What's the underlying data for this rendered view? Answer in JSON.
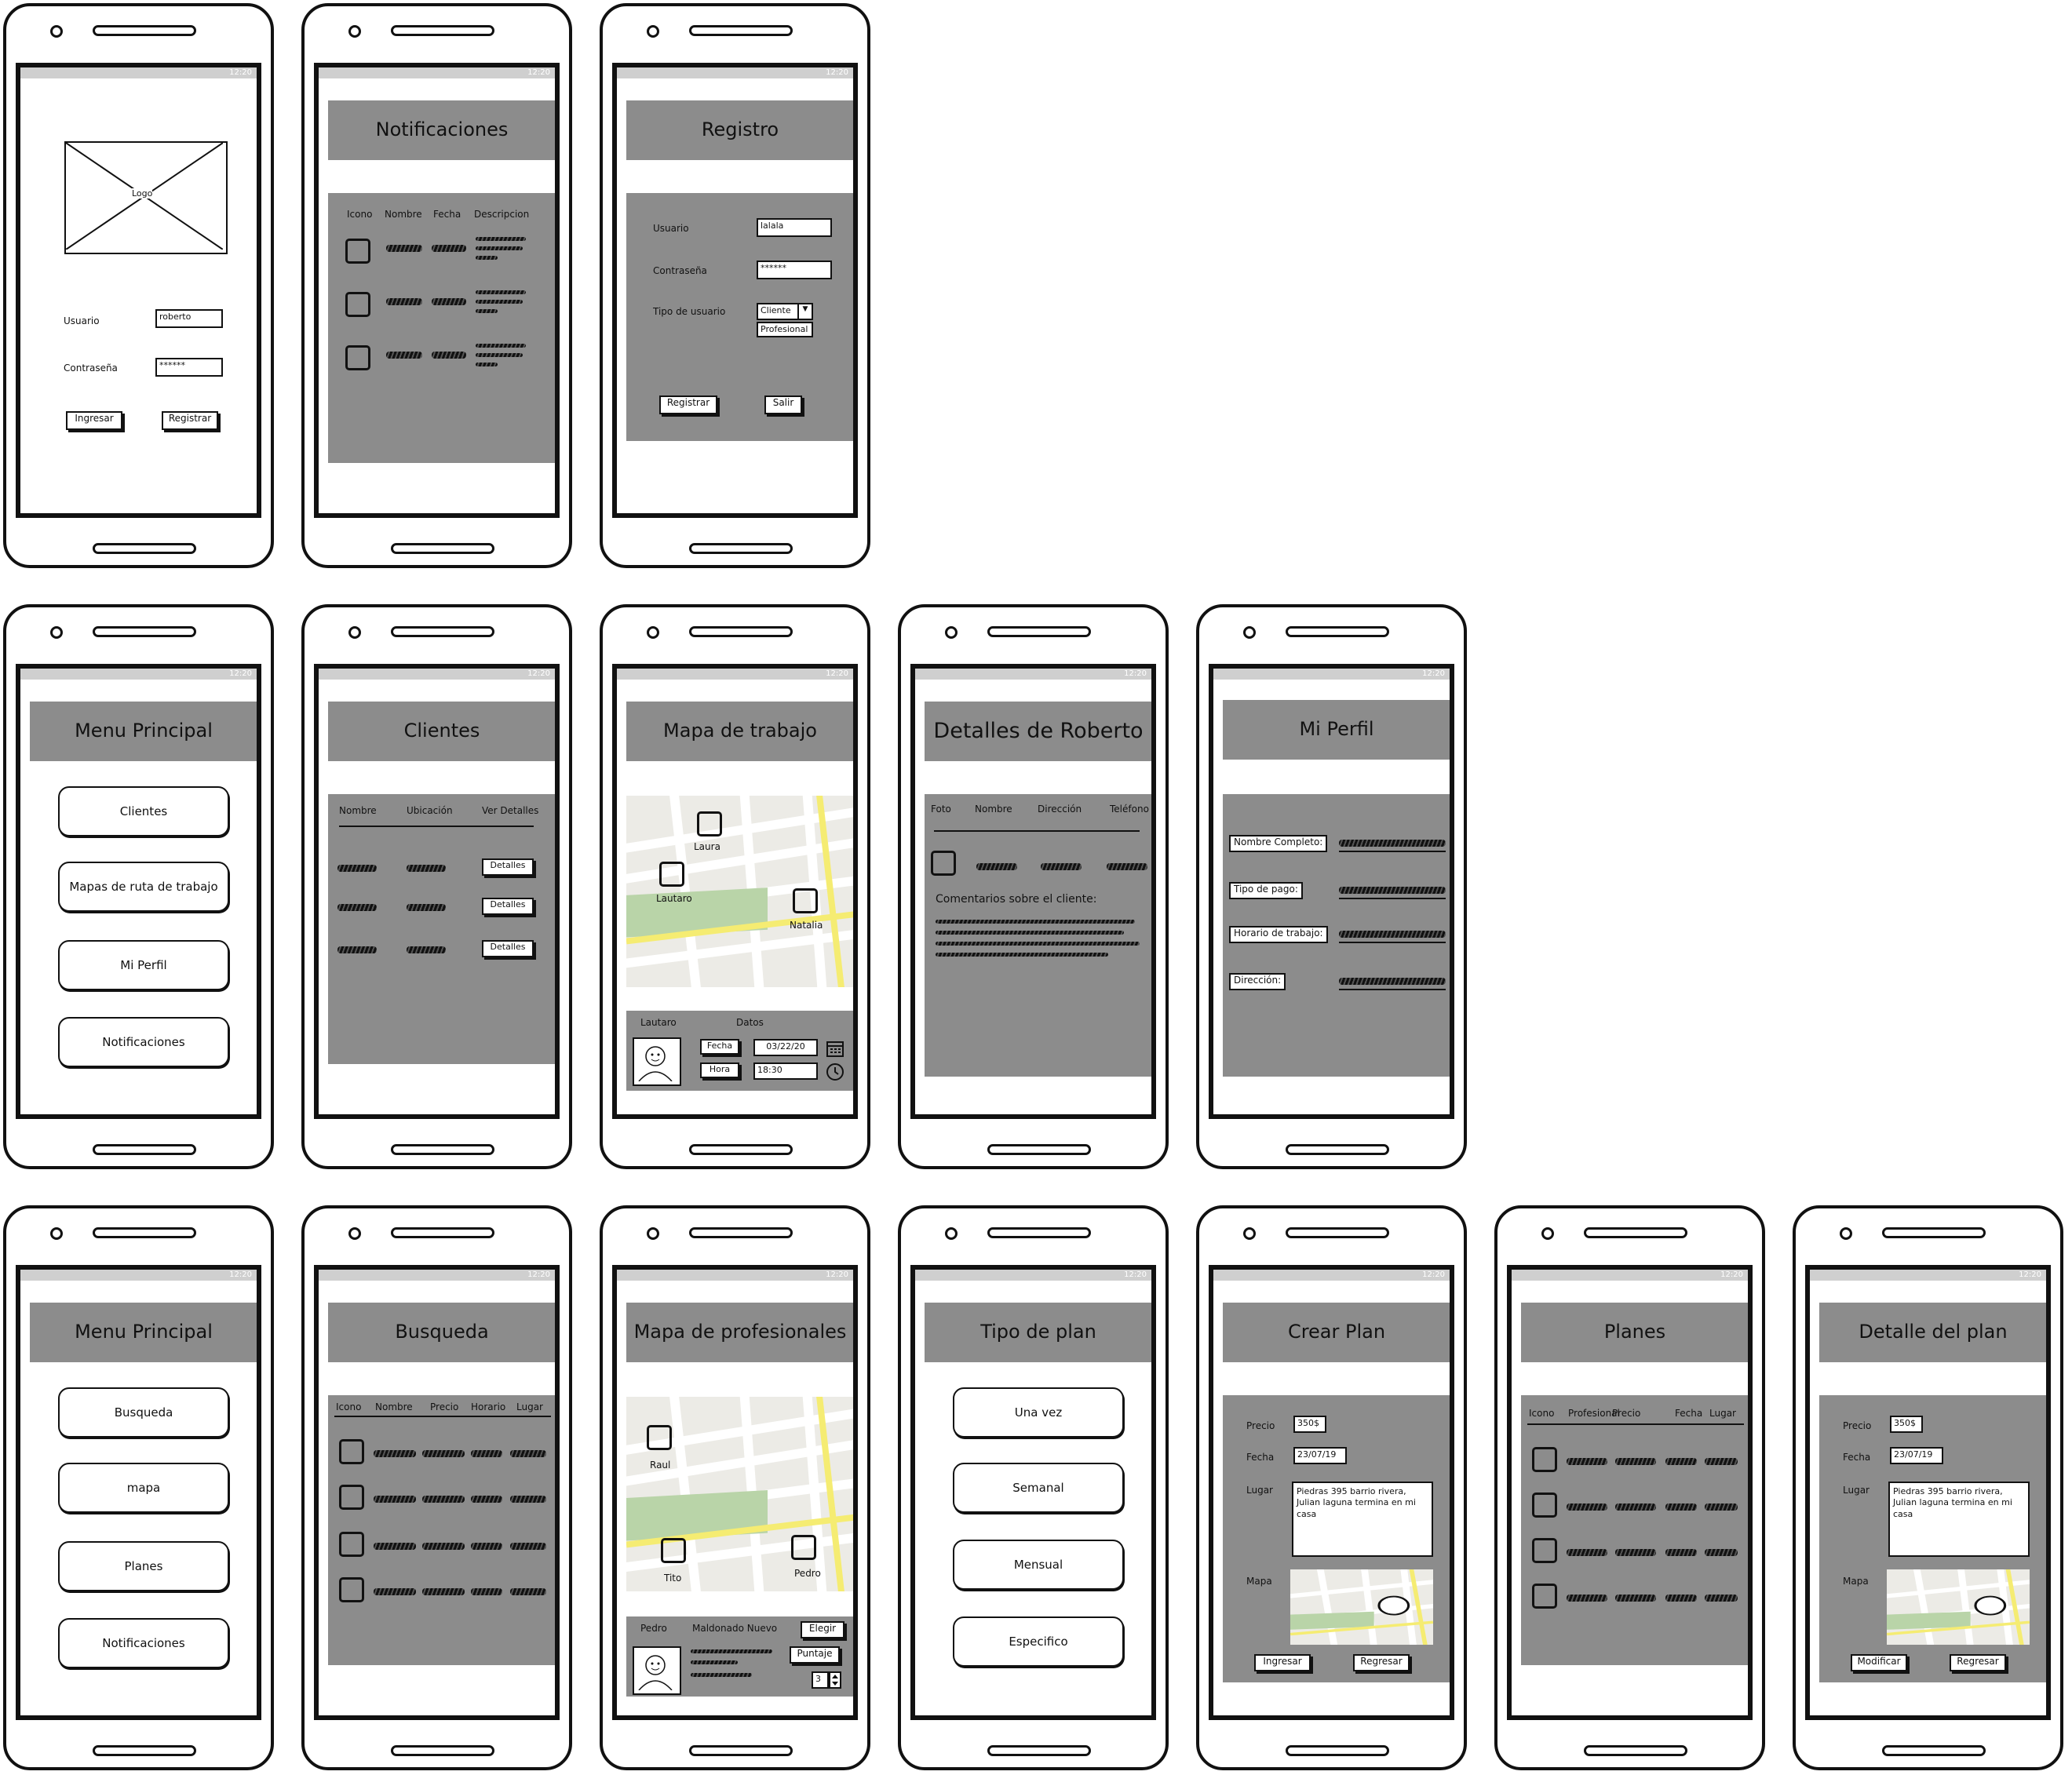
{
  "status": {
    "time": "12:20"
  },
  "login": {
    "logo": "Logo",
    "user_label": "Usuario",
    "user_value": "roberto",
    "pass_label": "Contraseña",
    "pass_value": "******",
    "login_btn": "Ingresar",
    "register_btn": "Registrar"
  },
  "notifications": {
    "title": "Notificaciones",
    "headers": [
      "Icono",
      "Nombre",
      "Fecha",
      "Descripcion"
    ]
  },
  "register": {
    "title": "Registro",
    "user_label": "Usuario",
    "user_value": "lalala",
    "pass_label": "Contraseña",
    "pass_value": "******",
    "type_label": "Tipo de usuario",
    "type_value": "Cliente",
    "type_option": "Profesional",
    "register_btn": "Registrar",
    "exit_btn": "Salir"
  },
  "menu_pro": {
    "title": "Menu Principal",
    "items": [
      "Clientes",
      "Mapas de ruta de trabajo",
      "Mi Perfil",
      "Notificaciones"
    ]
  },
  "clients": {
    "title": "Clientes",
    "headers": [
      "Nombre",
      "Ubicación",
      "Ver Detalles"
    ],
    "details_btn": "Detalles"
  },
  "work_map": {
    "title": "Mapa de trabajo",
    "pins": [
      "Laura",
      "Lautaro",
      "Natalia"
    ],
    "person": "Lautaro",
    "data_label": "Datos",
    "date_label": "Fecha",
    "date_value": "03/22/20",
    "time_label": "Hora",
    "time_value": "18:30"
  },
  "client_details": {
    "title": "Detalles de Roberto",
    "headers": [
      "Foto",
      "Nombre",
      "Dirección",
      "Teléfono"
    ],
    "comments_label": "Comentarios sobre el cliente:"
  },
  "profile": {
    "title": "Mi Perfil",
    "fields": [
      "Nombre Completo:",
      "Tipo de pago:",
      "Horario de trabajo:",
      "Dirección:"
    ]
  },
  "menu_client": {
    "title": "Menu Principal",
    "items": [
      "Busqueda",
      "mapa",
      "Planes",
      "Notificaciones"
    ]
  },
  "search": {
    "title": "Busqueda",
    "headers": [
      "Icono",
      "Nombre",
      "Precio",
      "Horario",
      "Lugar"
    ]
  },
  "pro_map": {
    "title": "Mapa de profesionales",
    "pins": [
      "Raul",
      "Tito",
      "Pedro"
    ],
    "person": "Pedro",
    "location": "Maldonado Nuevo",
    "choose_btn": "Elegir",
    "score_btn": "Puntaje",
    "score_value": "3"
  },
  "plan_type": {
    "title": "Tipo de plan",
    "items": [
      "Una vez",
      "Semanal",
      "Mensual",
      "Especifico"
    ]
  },
  "create_plan": {
    "title": "Crear Plan",
    "price_label": "Precio",
    "price_value": "350$",
    "date_label": "Fecha",
    "date_value": "23/07/19",
    "place_label": "Lugar",
    "place_value": "Piedras 395 barrio rivera, Julian laguna termina en mi casa",
    "map_label": "Mapa",
    "ok_btn": "Ingresar",
    "back_btn": "Regresar"
  },
  "plans": {
    "title": "Planes",
    "headers": [
      "Icono",
      "Profesional",
      "Precio",
      "Fecha",
      "Lugar"
    ]
  },
  "plan_detail": {
    "title": "Detalle del plan",
    "price_label": "Precio",
    "price_value": "350$",
    "date_label": "Fecha",
    "date_value": "23/07/19",
    "place_label": "Lugar",
    "place_value": "Piedras 395 barrio rivera, Julian laguna termina en mi casa",
    "map_label": "Mapa",
    "edit_btn": "Modificar",
    "back_btn": "Regresar"
  }
}
